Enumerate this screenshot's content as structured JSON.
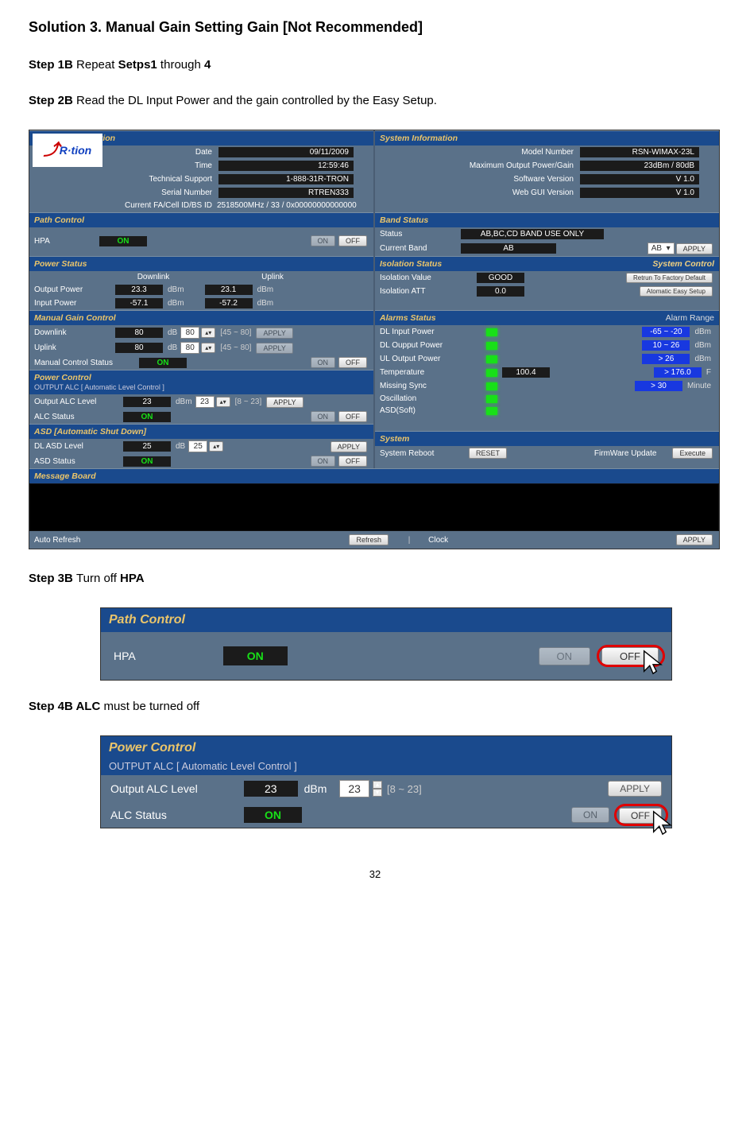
{
  "doc": {
    "solution_title": "Solution 3. Manual Gain Setting Gain [Not Recommended]",
    "step1b_prefix": "Step 1B ",
    "step1b_mid1": "Repeat ",
    "step1b_b1": "Setps1",
    "step1b_mid2": " through ",
    "step1b_b2": "4",
    "step2b_prefix": "Step 2B ",
    "step2b_text": "Read the DL Input Power and the gain controlled by the Easy Setup.",
    "step3b_prefix": "Step 3B ",
    "step3b_text": "Turn off ",
    "step3b_b": "HPA",
    "step4b_prefix": "Step 4B ",
    "step4b_b": "ALC",
    "step4b_text": " must be turned off",
    "page_number": "32"
  },
  "netinfo": {
    "title": "Network Information",
    "logo": "R·tion",
    "rows": {
      "date_l": "Date",
      "date_v": "09/11/2009",
      "time_l": "Time",
      "time_v": "12:59:46",
      "tech_l": "Technical Support",
      "tech_v": "1-888-31R-TRON",
      "sn_l": "Serial Number",
      "sn_v": "RTREN333",
      "fa_l": "Current FA/Cell ID/BS ID",
      "fa_v": "2518500MHz / 33 / 0x00000000000000"
    }
  },
  "sysinfo": {
    "title": "System Information",
    "rows": {
      "model_l": "Model Number",
      "model_v": "RSN-WIMAX-23L",
      "mop_l": "Maximum Output Power/Gain",
      "mop_v": "23dBm / 80dB",
      "sv_l": "Software Version",
      "sv_v": "V 1.0",
      "gv_l": "Web GUI Version",
      "gv_v": "V 1.0"
    }
  },
  "path": {
    "title": "Path Control",
    "hpa_l": "HPA",
    "hpa_v": "ON",
    "on": "ON",
    "off": "OFF"
  },
  "band": {
    "title": "Band Status",
    "status_l": "Status",
    "status_v": "AB,BC,CD BAND USE ONLY",
    "cb_l": "Current Band",
    "cb_v": "AB",
    "sel": "AB",
    "apply": "APPLY"
  },
  "power": {
    "title": "Power Status",
    "dl": "Downlink",
    "ul": "Uplink",
    "op_l": "Output Power",
    "op_dl": "23.3",
    "op_ul": "23.1",
    "ip_l": "Input Power",
    "ip_dl": "-57.1",
    "ip_ul": "-57.2",
    "unit": "dBm"
  },
  "iso": {
    "title": "Isolation Status",
    "sysctrl": "System Control",
    "iv_l": "Isolation Value",
    "iv_v": "GOOD",
    "ia_l": "Isolation ATT",
    "ia_v": "0.0",
    "b1": "Retrun To Factory Default",
    "b2": "Atomatic Easy Setup"
  },
  "mgc": {
    "title": "Manual Gain Control",
    "dl_l": "Downlink",
    "dl_v": "80",
    "dl_r": "[45 ~ 80]",
    "ul_l": "Uplink",
    "ul_v": "80",
    "ul_r": "[45 ~ 80]",
    "mcs_l": "Manual Control Status",
    "mcs_v": "ON",
    "unit": "dB",
    "apply": "APPLY",
    "on": "ON",
    "off": "OFF",
    "ibox": "80"
  },
  "alarms": {
    "title": "Alarms Status",
    "range_h": "Alarm Range",
    "r1_l": "DL Input Power",
    "r1_r": "-65 ~ -20",
    "r1_u": "dBm",
    "r2_l": "DL Oupput Power",
    "r2_r": "10 ~ 26",
    "r2_u": "dBm",
    "r3_l": "UL Output Power",
    "r3_r": "> 26",
    "r3_u": "dBm",
    "r4_l": "Temperature",
    "r4_v": "100.4",
    "r4_r": "> 176.0",
    "r4_u": "F",
    "r5_l": "Missing Sync",
    "r5_r": "> 30",
    "r5_u": "Minute",
    "r6_l": "Oscillation",
    "r7_l": "ASD(Soft)"
  },
  "pc": {
    "title": "Power Control",
    "sub": "OUTPUT ALC [ Automatic Level Control ]",
    "oal_l": "Output ALC Level",
    "oal_v": "23",
    "unit": "dBm",
    "ibox": "23",
    "range": "[8 ~ 23]",
    "apply": "APPLY",
    "als_l": "ALC Status",
    "als_v": "ON",
    "on": "ON",
    "off": "OFF"
  },
  "asd": {
    "title": "ASD [Automatic Shut Down]",
    "dl_l": "DL ASD Level",
    "dl_v": "25",
    "unit": "dB",
    "ibox": "25",
    "apply": "APPLY",
    "as_l": "ASD Status",
    "as_v": "ON",
    "on": "ON",
    "off": "OFF"
  },
  "system": {
    "title": "System",
    "sr_l": "System Reboot",
    "reset": "RESET",
    "fw_l": "FirmWare Update",
    "exec": "Execute"
  },
  "msg": {
    "title": "Message Board"
  },
  "autorefresh": {
    "label": "Auto Refresh",
    "refresh": "Refresh",
    "clock": "Clock",
    "apply": "APPLY"
  },
  "p3b": {
    "title": "Path Control",
    "hpa": "HPA",
    "on_v": "ON",
    "on_b": "ON",
    "off_b": "OFF"
  },
  "p4b": {
    "title": "Power Control",
    "sub": "OUTPUT ALC [ Automatic Level Control ]",
    "oal_l": "Output ALC Level",
    "oal_v": "23",
    "unit": "dBm",
    "ibox": "23",
    "range": "[8 ~ 23]",
    "apply": "APPLY",
    "als_l": "ALC Status",
    "als_v": "ON",
    "on": "ON",
    "off": "OFF"
  }
}
